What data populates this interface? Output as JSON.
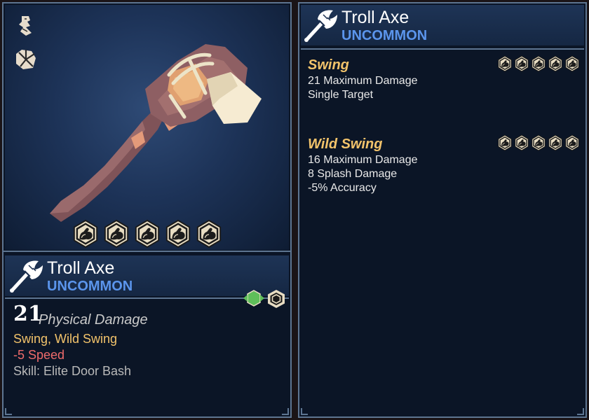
{
  "item": {
    "name": "Troll Axe",
    "rarity": "UNCOMMON",
    "damage_value": "21",
    "damage_type": "Physical Damage",
    "skills_line": "Swing, Wild Swing",
    "speed_line": "-5 Speed",
    "skill_line": "Skill: Elite Door Bash",
    "strength_requirement": 5
  },
  "side_icons": [
    "bone-icon",
    "impact-icon"
  ],
  "badges": [
    "arrows-badge-icon",
    "hexagon-badge-icon"
  ],
  "skills": [
    {
      "name": "Swing",
      "lines": [
        "21 Maximum Damage",
        "Single Target"
      ],
      "strength_icons": 5
    },
    {
      "name": "Wild Swing",
      "lines": [
        "16 Maximum Damage",
        "8 Splash Damage",
        "-5% Accuracy"
      ],
      "strength_icons": 5
    }
  ],
  "colors": {
    "rarity": "#5b95ec",
    "skill_name": "#f2c36b",
    "skills_line": "#f2c36b",
    "speed_line": "#ee6b6b",
    "skill_line": "#b9b9b9",
    "panel_border": "#5d7591"
  }
}
